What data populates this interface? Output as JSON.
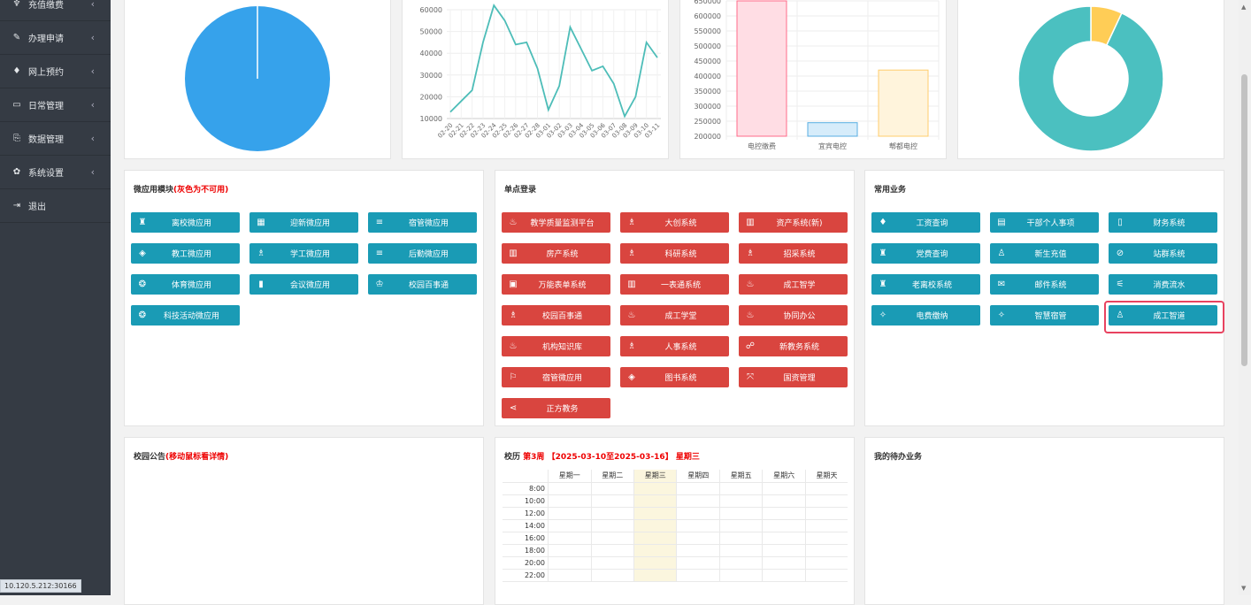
{
  "sidebar": {
    "items": [
      {
        "icon": "recharge-icon",
        "glyph": "♆",
        "label": "充值缴费"
      },
      {
        "icon": "apply-icon",
        "glyph": "✎",
        "label": "办理申请"
      },
      {
        "icon": "diamond-icon",
        "glyph": "♦",
        "label": "网上预约"
      },
      {
        "icon": "daily-icon",
        "glyph": "▭",
        "label": "日常管理"
      },
      {
        "icon": "data-icon",
        "glyph": "⎘",
        "label": "数据管理"
      },
      {
        "icon": "gear-icon",
        "glyph": "✿",
        "label": "系统设置"
      },
      {
        "icon": "logout-icon",
        "glyph": "⇥",
        "label": "退出"
      }
    ]
  },
  "status_ip": "10.120.5.212:30166",
  "charts": {
    "line": {
      "chart_data": {
        "type": "line",
        "x": [
          "02-20",
          "02-21",
          "02-22",
          "02-23",
          "02-24",
          "02-25",
          "02-26",
          "02-27",
          "02-28",
          "03-01",
          "03-02",
          "03-03",
          "03-04",
          "03-05",
          "03-06",
          "03-07",
          "03-08",
          "03-09",
          "03-10",
          "03-11"
        ],
        "values": [
          13000,
          18000,
          23000,
          45000,
          62000,
          55000,
          44000,
          45000,
          33000,
          14000,
          25000,
          52000,
          42000,
          32000,
          34000,
          26000,
          11000,
          20000,
          45000,
          38000
        ],
        "ylim": [
          10000,
          60000
        ],
        "yticks": [
          10000,
          20000,
          30000,
          40000,
          50000,
          60000
        ],
        "color": "#4dbdb8"
      }
    },
    "bar": {
      "chart_data": {
        "type": "bar",
        "categories": [
          "电控缴费",
          "宜宾电控",
          "郫都电控"
        ],
        "values": [
          650000,
          245000,
          420000
        ],
        "ylim": [
          200000,
          650000
        ],
        "yticks": [
          200000,
          250000,
          300000,
          350000,
          400000,
          450000,
          500000,
          550000,
          600000,
          650000
        ],
        "fills": [
          "#ffdde4",
          "#d6ecfa",
          "#fff4dc"
        ],
        "strokes": [
          "#ff6b8a",
          "#58aee2",
          "#ffcd6b"
        ]
      }
    },
    "pie": {
      "chart_data": {
        "type": "pie",
        "values": [
          100
        ],
        "colors": [
          "#36a2eb"
        ]
      }
    },
    "donut": {
      "chart_data": {
        "type": "pie",
        "values": [
          93,
          7
        ],
        "colors": [
          "#4bc0c0",
          "#ffcd56"
        ]
      }
    }
  },
  "micro_apps": {
    "title": "微应用模块",
    "note": "(灰色为不可用)",
    "buttons": [
      {
        "icon": "building-icon",
        "glyph": "♜",
        "label": "离校微应用"
      },
      {
        "icon": "grid-icon",
        "glyph": "▦",
        "label": "迎新微应用"
      },
      {
        "icon": "list-icon",
        "glyph": "≡",
        "label": "宿管微应用"
      },
      {
        "icon": "layers-icon",
        "glyph": "◈",
        "label": "教工微应用"
      },
      {
        "icon": "users-icon",
        "glyph": "♗",
        "label": "学工微应用"
      },
      {
        "icon": "list-icon",
        "glyph": "≡",
        "label": "后勤微应用"
      },
      {
        "icon": "sport-icon",
        "glyph": "❂",
        "label": "体育微应用"
      },
      {
        "icon": "chart-icon",
        "glyph": "▮",
        "label": "会议微应用"
      },
      {
        "icon": "graduate-icon",
        "glyph": "♔",
        "label": "校园百事通"
      },
      {
        "icon": "tech-icon",
        "glyph": "❂",
        "label": "科技活动微应用"
      }
    ]
  },
  "sso": {
    "title": "单点登录",
    "buttons": [
      {
        "icon": "fire-icon",
        "glyph": "♨",
        "label": "教学质量监测平台"
      },
      {
        "icon": "users-icon",
        "glyph": "♗",
        "label": "大创系统"
      },
      {
        "icon": "book-icon",
        "glyph": "▥",
        "label": "资产系统(新)"
      },
      {
        "icon": "book-icon",
        "glyph": "▥",
        "label": "房产系统"
      },
      {
        "icon": "users-icon",
        "glyph": "♗",
        "label": "科研系统"
      },
      {
        "icon": "users-icon",
        "glyph": "♗",
        "label": "招采系统"
      },
      {
        "icon": "form-icon",
        "glyph": "▣",
        "label": "万能表单系统"
      },
      {
        "icon": "book-icon",
        "glyph": "▥",
        "label": "一表通系统"
      },
      {
        "icon": "fire-icon",
        "glyph": "♨",
        "label": "成工智学"
      },
      {
        "icon": "users-icon",
        "glyph": "♗",
        "label": "校园百事通"
      },
      {
        "icon": "fire-icon",
        "glyph": "♨",
        "label": "成工学堂"
      },
      {
        "icon": "fire-icon",
        "glyph": "♨",
        "label": "协同办公"
      },
      {
        "icon": "fire-icon",
        "glyph": "♨",
        "label": "机构知识库"
      },
      {
        "icon": "users-icon",
        "glyph": "♗",
        "label": "人事系统"
      },
      {
        "icon": "link-icon",
        "glyph": "☍",
        "label": "新教务系统"
      },
      {
        "icon": "flag-icon",
        "glyph": "⚐",
        "label": "宿管微应用"
      },
      {
        "icon": "layers-icon",
        "glyph": "◈",
        "label": "图书系统"
      },
      {
        "icon": "expand-icon",
        "glyph": "⤧",
        "label": "国资管理"
      },
      {
        "icon": "share-icon",
        "glyph": "⋖",
        "label": "正方教务"
      }
    ]
  },
  "common": {
    "title": "常用业务",
    "buttons": [
      {
        "icon": "diamond-icon",
        "glyph": "♦",
        "label": "工资查询"
      },
      {
        "icon": "id-card-icon",
        "glyph": "▤",
        "label": "干部个人事项"
      },
      {
        "icon": "column-icon",
        "glyph": "▯",
        "label": "财务系统"
      },
      {
        "icon": "building-icon",
        "glyph": "♜",
        "label": "党费查询"
      },
      {
        "icon": "user-icon",
        "glyph": "♙",
        "label": "新生充值"
      },
      {
        "icon": "ban-icon",
        "glyph": "⊘",
        "label": "站群系统"
      },
      {
        "icon": "building-icon",
        "glyph": "♜",
        "label": "老离校系统"
      },
      {
        "icon": "mail-icon",
        "glyph": "✉",
        "label": "邮件系统"
      },
      {
        "icon": "sliders-icon",
        "glyph": "⚟",
        "label": "消费流水"
      },
      {
        "icon": "tag-icon",
        "glyph": "✧",
        "label": "电费缴纳"
      },
      {
        "icon": "tag-icon",
        "glyph": "✧",
        "label": "智慧宿管"
      },
      {
        "icon": "user-icon",
        "glyph": "♙",
        "label": "成工智道"
      }
    ]
  },
  "notice": {
    "title": "校园公告",
    "note": "(移动鼠标看详情)"
  },
  "calendar": {
    "prefix": "校历",
    "week": "第3周",
    "range": "【2025-03-10至2025-03-16】",
    "day": "星期三",
    "days": [
      "星期一",
      "星期二",
      "星期三",
      "星期四",
      "星期五",
      "星期六",
      "星期天"
    ],
    "times": [
      "8:00",
      "10:00",
      "12:00",
      "14:00",
      "16:00",
      "18:00",
      "20:00",
      "22:00"
    ]
  },
  "todo": {
    "title": "我的待办业务"
  }
}
